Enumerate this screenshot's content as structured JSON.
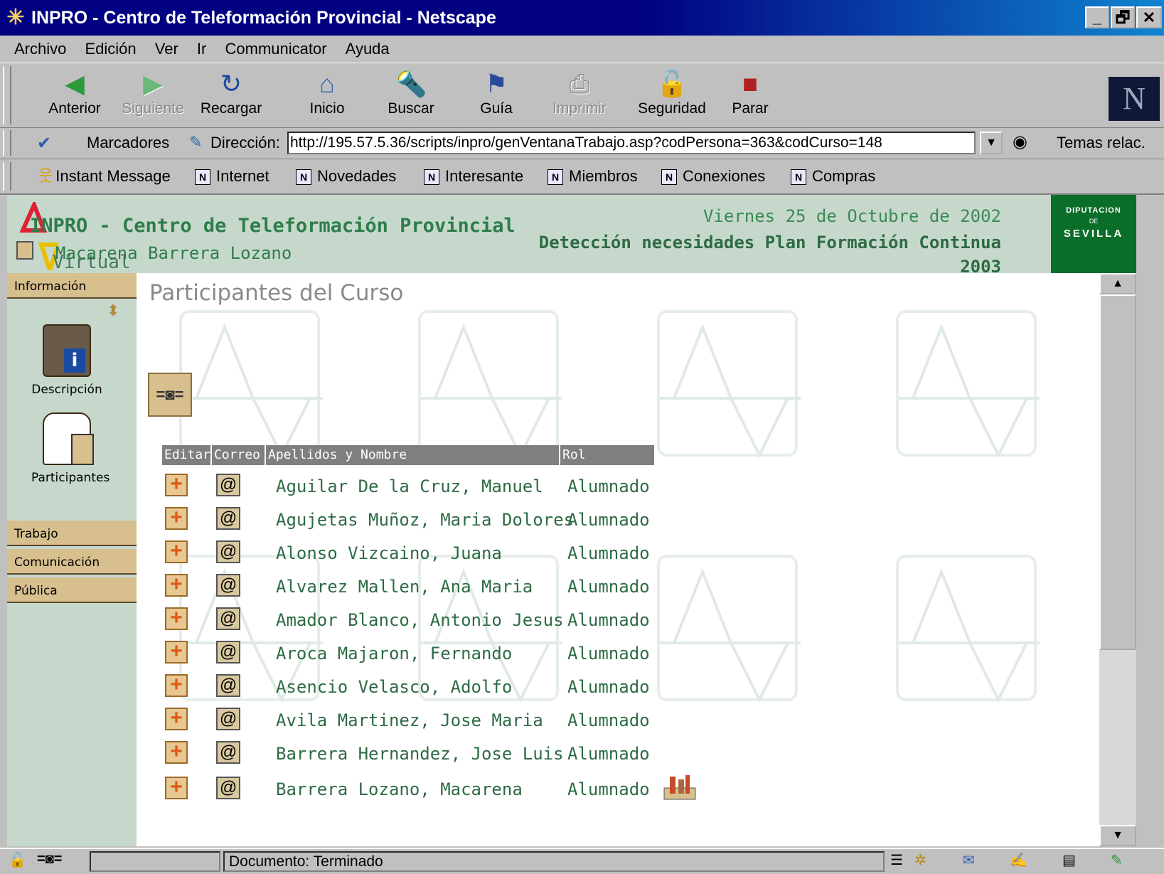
{
  "window": {
    "title": "INPRO - Centro de Teleformación Provincial - Netscape",
    "controls": [
      "_",
      "🗗",
      "✕"
    ]
  },
  "menu": [
    "Archivo",
    "Edición",
    "Ver",
    "Ir",
    "Communicator",
    "Ayuda"
  ],
  "toolbar": {
    "buttons": [
      {
        "label": "Anterior",
        "icon": "back-icon",
        "glyph": "◀",
        "disabled": false
      },
      {
        "label": "Siguiente",
        "icon": "forward-icon",
        "glyph": "▶",
        "disabled": true
      },
      {
        "label": "Recargar",
        "icon": "reload-icon",
        "glyph": "↻",
        "disabled": false
      },
      {
        "label": "Inicio",
        "icon": "home-icon",
        "glyph": "⌂",
        "disabled": false
      },
      {
        "label": "Buscar",
        "icon": "search-icon",
        "glyph": "🔦",
        "disabled": false
      },
      {
        "label": "Guía",
        "icon": "guide-icon",
        "glyph": "⚑",
        "disabled": false
      },
      {
        "label": "Imprimir",
        "icon": "print-icon",
        "glyph": "⎙",
        "disabled": true
      },
      {
        "label": "Seguridad",
        "icon": "lock-icon",
        "glyph": "🔓",
        "disabled": false
      },
      {
        "label": "Parar",
        "icon": "stop-icon",
        "glyph": "■",
        "disabled": false
      }
    ],
    "logo": "N"
  },
  "location": {
    "bookmarks_label": "Marcadores",
    "address_label": "Dirección:",
    "url": "http://195.57.5.36/scripts/inpro/genVentanaTrabajo.asp?codPersona=363&codCurso=148",
    "related_label": "Temas relac."
  },
  "personal_toolbar": [
    "Instant Message",
    "Internet",
    "Novedades",
    "Interesante",
    "Miembros",
    "Conexiones",
    "Compras"
  ],
  "page": {
    "site_title": "INPRO - Centro de Teleformación Provincial",
    "user_name": "Macarena Barrera Lozano",
    "logo_text": "Virtual",
    "date": "Viernes 25 de Octubre de 2002",
    "course_line1": "Detección necesidades Plan Formación Continua",
    "course_line2": "2003",
    "seal_top": "DIPUTACION",
    "seal_mid": "DE",
    "seal_bottom": "SEVILLA",
    "heading": "Participantes del Curso"
  },
  "sidebar": {
    "info_label": "Información",
    "items": [
      {
        "label": "Descripción",
        "icon": "description-icon"
      },
      {
        "label": "Participantes",
        "icon": "participants-icon"
      }
    ],
    "sections": [
      "Trabajo",
      "Comunicación",
      "Pública"
    ]
  },
  "table": {
    "headers": [
      "Editar",
      "Correo",
      "Apellidos y Nombre",
      "Rol"
    ],
    "rows": [
      {
        "name": "Aguilar De la Cruz, Manuel",
        "role": "Alumnado"
      },
      {
        "name": "Agujetas Muñoz, Maria Dolores",
        "role": "Alumnado"
      },
      {
        "name": "Alonso Vizcaino, Juana",
        "role": "Alumnado"
      },
      {
        "name": "Alvarez Mallen, Ana Maria",
        "role": "Alumnado"
      },
      {
        "name": "Amador Blanco, Antonio Jesus",
        "role": "Alumnado"
      },
      {
        "name": "Aroca Majaron, Fernando",
        "role": "Alumnado"
      },
      {
        "name": "Asencio Velasco, Adolfo",
        "role": "Alumnado"
      },
      {
        "name": "Avila Martinez, Jose Maria",
        "role": "Alumnado"
      },
      {
        "name": "Barrera Hernandez, Jose Luis",
        "role": "Alumnado"
      },
      {
        "name": "Barrera Lozano, Macarena",
        "role": "Alumnado"
      }
    ]
  },
  "status": {
    "text": "Documento: Terminado"
  },
  "colors": {
    "title_bar": "#000080",
    "banner_bg": "#c6d8cc",
    "accent_green": "#2e6b44",
    "sidebar_button": "#d7bf8e"
  }
}
